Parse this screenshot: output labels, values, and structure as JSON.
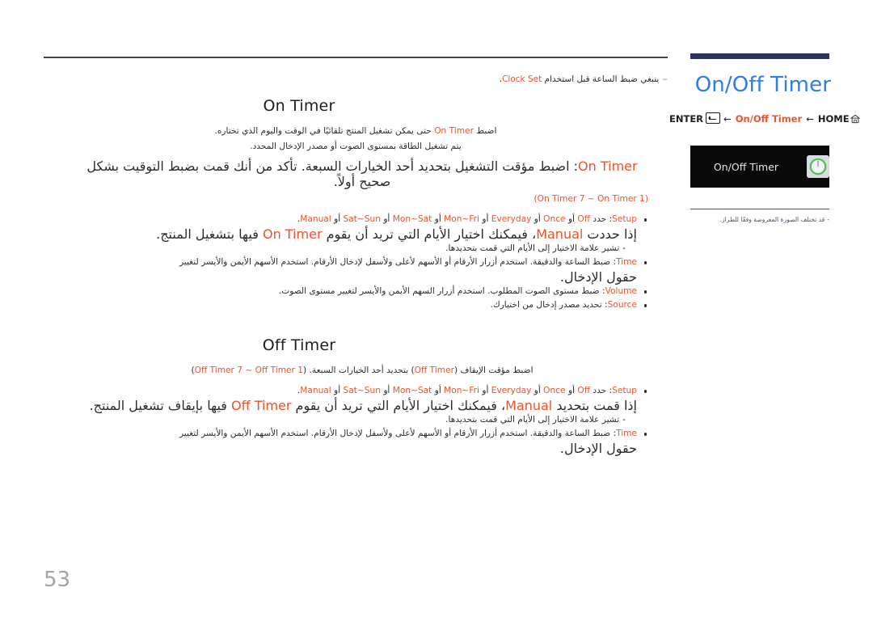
{
  "header": {
    "title": "On/Off Timer",
    "breadcrumb": {
      "enter_label": "ENTER",
      "enter_icon": "enter-key-icon",
      "arrow1": "←",
      "current": "On/Off Timer",
      "arrow2": "←",
      "home_label": "HOME",
      "home_icon": "home-icon"
    },
    "title_color": "#2f7cea",
    "accent_color": "#e8542c",
    "rule_color": "#2b3158"
  },
  "osd": {
    "icon": "power-timer-icon",
    "label": "On/Off Timer",
    "note_dash": "-",
    "note": "قد تختلف الصورة المعروضة وفقًا للطراز."
  },
  "intro": {
    "dash": "‒",
    "text_before": "ينبغي ضبط الساعة قبل استخدام ",
    "term": "Clock Set",
    "text_after": "."
  },
  "on_timer": {
    "heading": "On Timer",
    "para_line1_before": "اضبط ",
    "para_line1_term": "On Timer",
    "para_line1_after": " حتى يمكن تشغيل المنتج تلقائيًا في الوقت واليوم الذي تختاره.",
    "para_line2": "يتم تشغيل الطاقة بمستوى الصوت أو مصدر الإدخال المحدد.",
    "setup_lead_term": "On Timer",
    "setup_lead_text": ": اضبط مؤقت التشغيل بتحديد أحد الخيارات السبعة. تأكد من أنك قمت بضبط التوقيت بشكل صحيح أولاً.",
    "setup_paren": "(On Timer 7 ~ On Timer 1)",
    "bullets": [
      {
        "term": "Setup",
        "text": ": حدد ",
        "options": [
          "Off",
          "Once",
          "Everyday",
          "Mon~Fri",
          "Mon~Sat",
          "Sat~Sun",
          "Manual"
        ],
        "options_sep": " أو ",
        "tail": ".",
        "cont_before": "إذا حددت ",
        "cont_term": "Manual",
        "cont_mid": "، فيمكنك اختيار الأيام التي تريد أن يقوم ",
        "cont_term2": "On Timer",
        "cont_after": " فيها بتشغيل المنتج.",
        "sub_dash": "-",
        "sub_text": "تشير علامة الاختيار إلى الأيام التي قمت بتحديدها."
      },
      {
        "term": "Time",
        "text": ": ضبط الساعة والدقيقة. استخدم أزرار الأرقام أو الأسهم لأعلى ولأسفل لإدخال الأرقام. استخدم الأسهم الأيمن والأيسر لتغيير",
        "line2": "حقول الإدخال."
      },
      {
        "term": "Volume",
        "text": ": ضبط مستوى الصوت المطلوب. استخدم أزرار السهم الأيمن والأيسر لتغيير مستوى الصوت."
      },
      {
        "term": "Source",
        "text": ": تحديد مصدر إدخال من اختيارك."
      }
    ]
  },
  "off_timer": {
    "heading": "Off Timer",
    "lead_before": "اضبط مؤقت الإيقاف (",
    "lead_term": "Off Timer",
    "lead_mid": ") بتحديد أحد الخيارات السبعة. (",
    "lead_paren": "Off Timer 7 ~ Off Timer 1",
    "lead_after": ")",
    "bullets": [
      {
        "term": "Setup",
        "text": ": حدد ",
        "options": [
          "Off",
          "Once",
          "Everyday",
          "Mon~Fri",
          "Mon~Sat",
          "Sat~Sun",
          "Manual"
        ],
        "options_sep": " أو ",
        "tail": ".",
        "cont_before": "إذا قمت بتحديد ",
        "cont_term": "Manual",
        "cont_mid": "، فيمكنك اختيار الأيام التي تريد أن يقوم ",
        "cont_term2": "Off Timer",
        "cont_after": " فيها بإيقاف تشغيل المنتج.",
        "sub_dash": "-",
        "sub_text": "تشير علامة الاختيار إلى الأيام التي قمت بتحديدها."
      },
      {
        "term": "Time",
        "text": ": ضبط الساعة والدقيقة. استخدم أزرار الأرقام أو الأسهم لأعلى ولأسفل لإدخال الأرقام. استخدم الأسهم الأيمن والأيسر لتغيير",
        "line2": "حقول الإدخال."
      }
    ]
  },
  "footer": {
    "page_number": "53"
  }
}
